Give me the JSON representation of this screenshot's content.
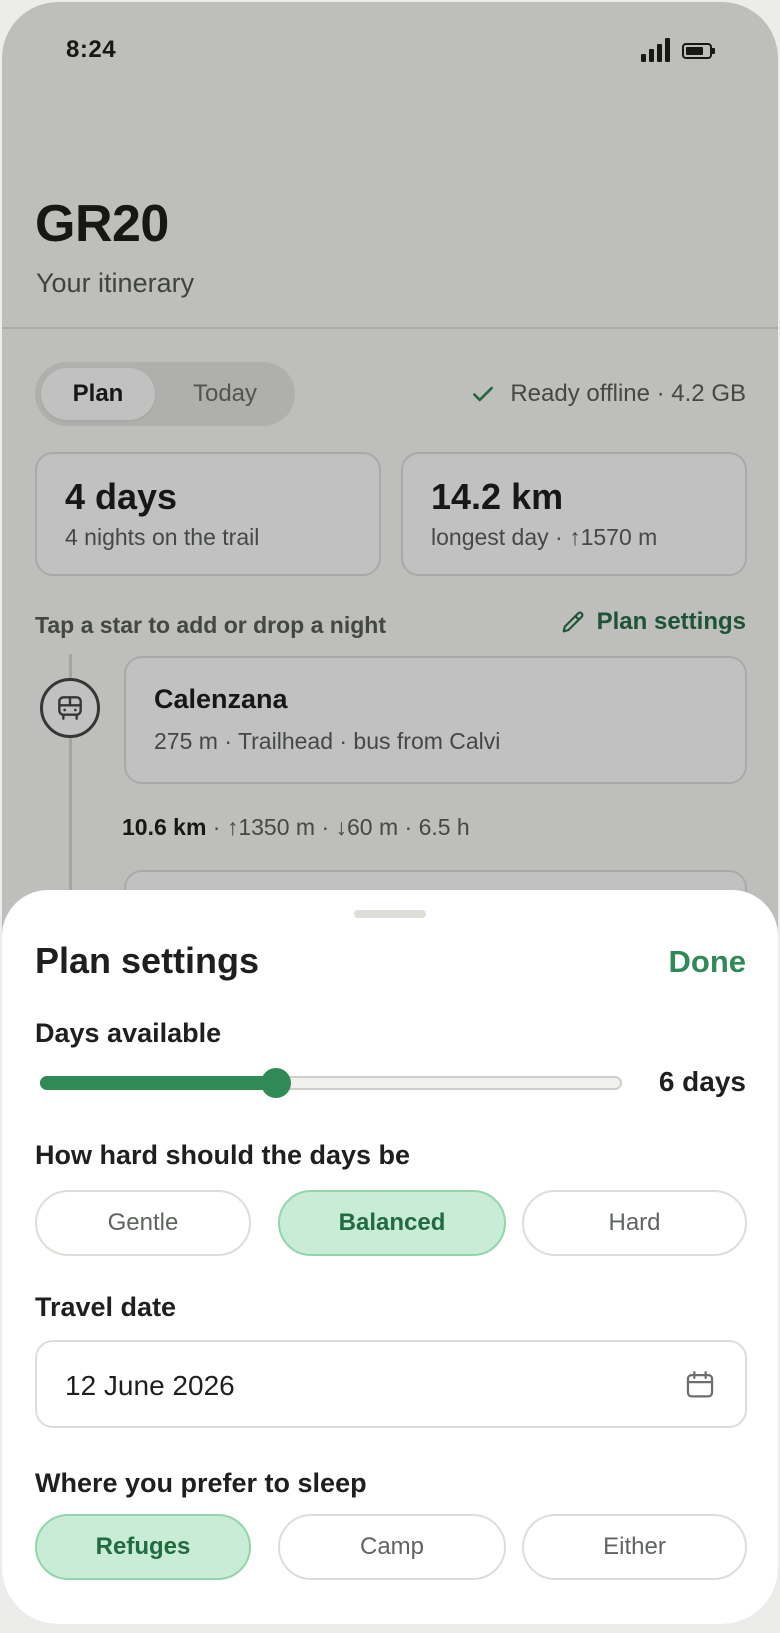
{
  "status_bar": {
    "time": "8:24"
  },
  "header": {
    "title": "GR20",
    "subtitle": "Your itinerary"
  },
  "mode_tabs": [
    {
      "label": "Plan",
      "selected": true
    },
    {
      "label": "Today",
      "selected": false
    }
  ],
  "offline_status": "Ready offline · 4.2 GB",
  "stats": [
    {
      "value": "4 days",
      "detail": "4 nights on the trail"
    },
    {
      "value": "14.2 km",
      "detail": "longest day · ↑1570 m"
    }
  ],
  "hint": "Tap a star to add or drop a night",
  "plan_settings_link": "Plan settings",
  "stops": [
    {
      "name": "Calenzana",
      "meta": "275 m · Trailhead · bus from Calvi",
      "icon": "bus-icon"
    }
  ],
  "legs": [
    {
      "distance": "10.6 km",
      "detail": " · ↑1350 m · ↓60 m · 6.5 h"
    }
  ],
  "sheet": {
    "title": "Plan settings",
    "done_label": "Done",
    "days_label": "Days available",
    "days_value": "6 days",
    "days_slider_fraction": 0.405,
    "difficulty_label": "How hard should the days be",
    "difficulty_options": [
      {
        "label": "Gentle",
        "selected": false
      },
      {
        "label": "Balanced",
        "selected": true
      },
      {
        "label": "Hard",
        "selected": false
      }
    ],
    "date_label": "Travel date",
    "date_value": "12 June 2026",
    "sleep_label": "Where you prefer to sleep",
    "sleep_options": [
      {
        "label": "Refuges",
        "selected": true
      },
      {
        "label": "Camp",
        "selected": false
      },
      {
        "label": "Either",
        "selected": false
      }
    ]
  },
  "colors": {
    "accent": "#2f8a57",
    "accent_soft": "#c8ecd6",
    "accent_text": "#226a3f"
  }
}
